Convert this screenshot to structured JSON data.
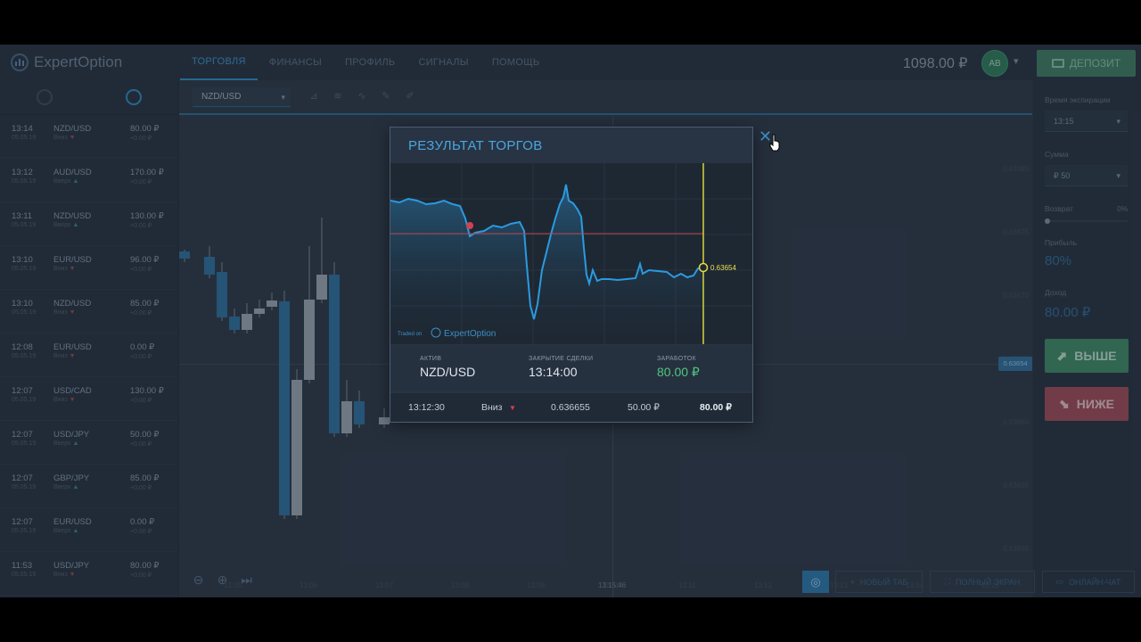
{
  "app": {
    "logo": "ExpertOption",
    "nav": [
      "ТОРГОВЛЯ",
      "ФИНАНСЫ",
      "ПРОФИЛЬ",
      "СИГНАЛЫ",
      "ПОМОЩЬ"
    ],
    "balance": "1098.00 ₽",
    "avatar": "AB",
    "deposit_label": "ДЕПОЗИТ"
  },
  "deals": [
    {
      "time": "13:14",
      "date": "05.05.19",
      "pair": "NZD/USD",
      "dir": "Вниз",
      "trend": "down",
      "amount": "80.00 ₽",
      "sub": "+0.00 ₽"
    },
    {
      "time": "13:12",
      "date": "05.05.19",
      "pair": "AUD/USD",
      "dir": "Вверх",
      "trend": "up",
      "amount": "170.00 ₽",
      "sub": "+0.00 ₽"
    },
    {
      "time": "13:11",
      "date": "05.05.19",
      "pair": "NZD/USD",
      "dir": "Вверх",
      "trend": "up",
      "amount": "130.00 ₽",
      "sub": "+0.00 ₽"
    },
    {
      "time": "13:10",
      "date": "05.05.19",
      "pair": "EUR/USD",
      "dir": "Вниз",
      "trend": "down",
      "amount": "96.00 ₽",
      "sub": "+0.00 ₽"
    },
    {
      "time": "13:10",
      "date": "05.05.19",
      "pair": "NZD/USD",
      "dir": "Вниз",
      "trend": "down",
      "amount": "85.00 ₽",
      "sub": "+0.00 ₽"
    },
    {
      "time": "12:08",
      "date": "05.05.19",
      "pair": "EUR/USD",
      "dir": "Вниз",
      "trend": "down",
      "amount": "0.00 ₽",
      "sub": "+0.00 ₽"
    },
    {
      "time": "12:07",
      "date": "05.05.19",
      "pair": "USD/CAD",
      "dir": "Вниз",
      "trend": "down",
      "amount": "130.00 ₽",
      "sub": "+0.00 ₽"
    },
    {
      "time": "12:07",
      "date": "05.05.19",
      "pair": "USD/JPY",
      "dir": "Вверх",
      "trend": "up",
      "amount": "50.00 ₽",
      "sub": "+0.00 ₽"
    },
    {
      "time": "12:07",
      "date": "05.05.19",
      "pair": "GBP/JPY",
      "dir": "Вверх",
      "trend": "up",
      "amount": "85.00 ₽",
      "sub": "+0.00 ₽"
    },
    {
      "time": "12:07",
      "date": "05.05.19",
      "pair": "EUR/USD",
      "dir": "Вверх",
      "trend": "up",
      "amount": "0.00 ₽",
      "sub": "+0.00 ₽"
    },
    {
      "time": "11:53",
      "date": "05.05.19",
      "pair": "USD/JPY",
      "dir": "Вниз",
      "trend": "down",
      "amount": "80.00 ₽",
      "sub": "+0.00 ₽"
    }
  ],
  "chart": {
    "pair": "NZD/USD",
    "price_tag": "0.63654",
    "crosshair_time": "13:15:46",
    "price_labels": [
      "0.63680",
      "0.63675",
      "0.63670",
      "0.63665",
      "0.63660",
      "0.63655",
      "0.63650",
      "0.63645"
    ],
    "time_ticks": [
      "13:05",
      "13:06",
      "13:07",
      "13:08",
      "13:09",
      "13:10",
      "13:11",
      "13:12",
      "13:13",
      "13:14",
      "13:15"
    ]
  },
  "right_panel": {
    "expiry_label": "Время экспирации",
    "expiry_value": "13:15",
    "amount_label": "Сумма",
    "amount_value": "₽ 50",
    "cashback_label": "Возврат",
    "cashback_value": "0%",
    "profit_label": "Прибыль",
    "profit_value": "80%",
    "income_label": "Доход",
    "income_value": "80.00 ₽",
    "up_label": "ВЫШЕ",
    "down_label": "НИЖЕ"
  },
  "bottom": {
    "new_tab": "НОВЫЙ ТАБ",
    "fullscreen": "ПОЛНЫЙ ЭКРАН",
    "chat": "ОНЛАЙН-ЧАТ"
  },
  "modal": {
    "title": "РЕЗУЛЬТАТ ТОРГОВ",
    "chart_price": "0.63654",
    "watermark_prefix": "Traded on",
    "watermark_brand": "ExpertOption",
    "asset_label": "АКТИВ",
    "asset_value": "NZD/USD",
    "close_label": "ЗАКРЫТИЕ СДЕЛКИ",
    "close_value": "13:14:00",
    "earn_label": "ЗАРАБОТОК",
    "earn_value": "80.00 ₽",
    "row": {
      "time": "13:12:30",
      "direction": "Вниз",
      "price": "0.636655",
      "stake": "50.00 ₽",
      "payout": "80.00 ₽"
    }
  },
  "colors": {
    "accent": "#2a8fcb",
    "up": "#3e8a66",
    "down": "#a04a57",
    "green_text": "#4fc67f",
    "yellow": "#f2e14c"
  }
}
